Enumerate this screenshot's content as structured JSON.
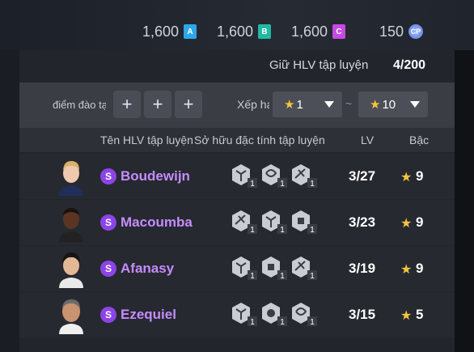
{
  "currencies": [
    {
      "amount": "1,600",
      "badge": "A",
      "color": "#2ea7e8"
    },
    {
      "amount": "1,600",
      "badge": "B",
      "color": "#22b9a3"
    },
    {
      "amount": "1,600",
      "badge": "C",
      "color": "#c64ae2"
    },
    {
      "amount": "150",
      "badge": "CP",
      "color": "#6f8de8"
    }
  ],
  "hold": {
    "label": "Giữ HLV tập luyện",
    "count": "4/200"
  },
  "filters": {
    "training_label": "điểm đào tạ",
    "rank_label": "Xếp hạ",
    "min": "1",
    "separator": "~",
    "max": "10",
    "plus": "+"
  },
  "columns": {
    "name": "Tên HLV tập luyện",
    "traits": "Sở hữu đặc tính tập luyện",
    "lv": "LV",
    "rank": "Bậc"
  },
  "coaches": [
    {
      "badge": "S",
      "name": "Boudewijn",
      "traits": [
        "1",
        "1",
        "1"
      ],
      "lv": "3/27",
      "rank": "9"
    },
    {
      "badge": "S",
      "name": "Macoumba",
      "traits": [
        "1",
        "1",
        "1"
      ],
      "lv": "3/23",
      "rank": "9"
    },
    {
      "badge": "S",
      "name": "Afanasy",
      "traits": [
        "1",
        "1",
        "1"
      ],
      "lv": "3/19",
      "rank": "9"
    },
    {
      "badge": "S",
      "name": "Ezequiel",
      "traits": [
        "1",
        "1",
        "1"
      ],
      "lv": "3/15",
      "rank": "5"
    }
  ]
}
